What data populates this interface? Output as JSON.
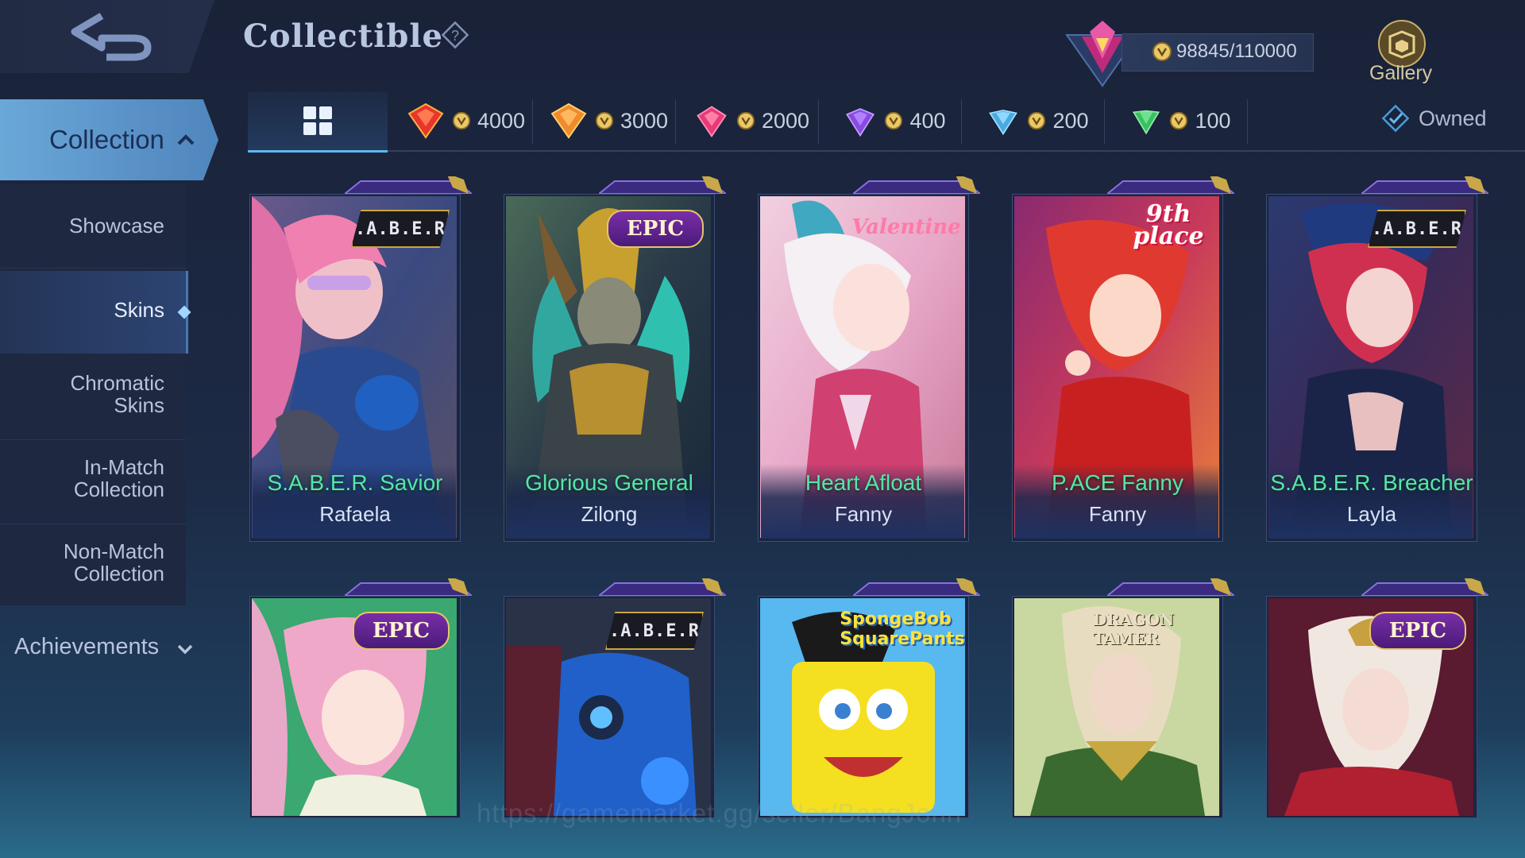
{
  "header": {
    "title": "Collectible",
    "points": "98845/110000",
    "gallery_label": "Gallery"
  },
  "sidebar": {
    "collection_label": "Collection",
    "items": [
      {
        "label": "Showcase"
      },
      {
        "label": "Skins"
      },
      {
        "label": "Chromatic Skins",
        "line1": "Chromatic",
        "line2": "Skins"
      },
      {
        "label": "In-Match Collection",
        "line1": "In-Match",
        "line2": "Collection"
      },
      {
        "label": "Non-Match Collection",
        "line1": "Non-Match",
        "line2": "Collection"
      }
    ],
    "achievements_label": "Achievements",
    "active": "Skins"
  },
  "filters": {
    "tabs": [
      {
        "value": "4000",
        "color": "#e8362c"
      },
      {
        "value": "3000",
        "color": "#f08a2a"
      },
      {
        "value": "2000",
        "color": "#e83a78"
      },
      {
        "value": "400",
        "color": "#8a4ae0"
      },
      {
        "value": "200",
        "color": "#4aaae0"
      },
      {
        "value": "100",
        "color": "#3ac060"
      }
    ],
    "owned_label": "Owned"
  },
  "cards_row1": [
    {
      "skin": "S.A.B.E.R. Savior",
      "hero": "Rafaela",
      "badge": "S.A.B.E.R."
    },
    {
      "skin": "Glorious General",
      "hero": "Zilong",
      "badge": "EPIC"
    },
    {
      "skin": "Heart Afloat",
      "hero": "Fanny",
      "badge": "Valentine"
    },
    {
      "skin": "P.ACE Fanny",
      "hero": "Fanny",
      "badge": "9th place"
    },
    {
      "skin": "S.A.B.E.R. Breacher",
      "hero": "Layla",
      "badge": "S.A.B.E.R."
    }
  ],
  "cards_row2": [
    {
      "badge": "EPIC"
    },
    {
      "badge": "S.A.B.E.R."
    },
    {
      "badge": "SpongeBob SquarePants"
    },
    {
      "badge": "DRAGON TAMER"
    },
    {
      "badge": "EPIC"
    }
  ],
  "colors": {
    "accent": "#5fb8f0",
    "skin_name": "#55e6a8",
    "background": "#1c2a45"
  },
  "watermark": "https://gamemarket.gg/seller/BangJohn"
}
